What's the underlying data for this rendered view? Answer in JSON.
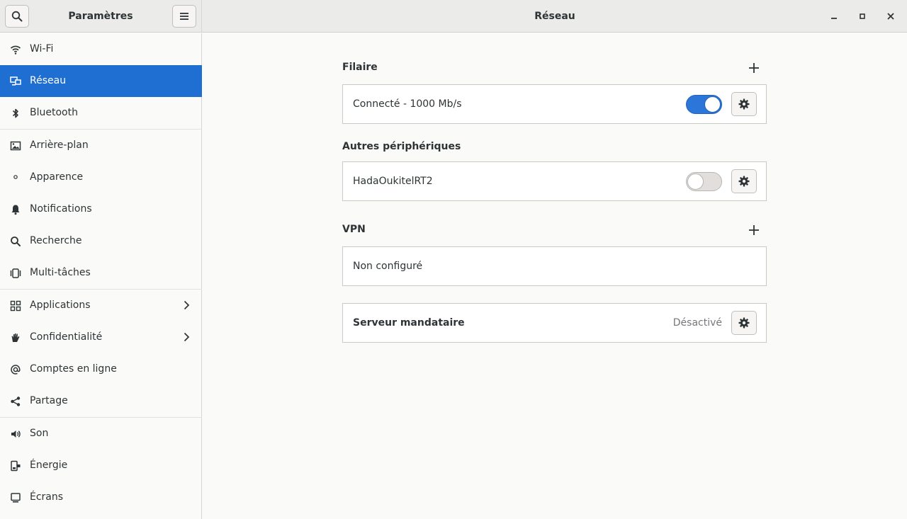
{
  "header": {
    "app_title": "Paramètres",
    "page_title": "Réseau"
  },
  "sidebar": {
    "items": [
      {
        "id": "wifi",
        "label": "Wi-Fi",
        "icon": "wifi-icon"
      },
      {
        "id": "network",
        "label": "Réseau",
        "icon": "network-icon",
        "active": true
      },
      {
        "id": "bluetooth",
        "label": "Bluetooth",
        "icon": "bluetooth-icon"
      },
      {
        "id": "background",
        "label": "Arrière-plan",
        "icon": "image-icon"
      },
      {
        "id": "appearance",
        "label": "Apparence",
        "icon": "appearance-icon"
      },
      {
        "id": "notifications",
        "label": "Notifications",
        "icon": "bell-icon"
      },
      {
        "id": "search",
        "label": "Recherche",
        "icon": "search-icon"
      },
      {
        "id": "multitasking",
        "label": "Multi-tâches",
        "icon": "multitasking-icon"
      },
      {
        "id": "applications",
        "label": "Applications",
        "icon": "apps-grid-icon",
        "submenu": true
      },
      {
        "id": "privacy",
        "label": "Confidentialité",
        "icon": "hand-icon",
        "submenu": true
      },
      {
        "id": "online-accounts",
        "label": "Comptes en ligne",
        "icon": "at-icon"
      },
      {
        "id": "sharing",
        "label": "Partage",
        "icon": "share-icon"
      },
      {
        "id": "sound",
        "label": "Son",
        "icon": "speaker-icon"
      },
      {
        "id": "power",
        "label": "Énergie",
        "icon": "power-icon"
      },
      {
        "id": "displays",
        "label": "Écrans",
        "icon": "display-icon"
      }
    ]
  },
  "main": {
    "wired": {
      "title": "Filaire",
      "connection_label": "Connecté - 1000 Mb/s",
      "enabled": true
    },
    "other_devices": {
      "title": "Autres périphériques",
      "device_label": "HadaOukitelRT2",
      "enabled": false
    },
    "vpn": {
      "title": "VPN",
      "status_label": "Non configuré"
    },
    "proxy": {
      "label": "Serveur mandataire",
      "status": "Désactivé"
    }
  },
  "colors": {
    "accent": "#1f6fd3",
    "toggle_on": "#2b76d8",
    "headerbar": "#ebebe9",
    "background": "#fafaf8"
  }
}
